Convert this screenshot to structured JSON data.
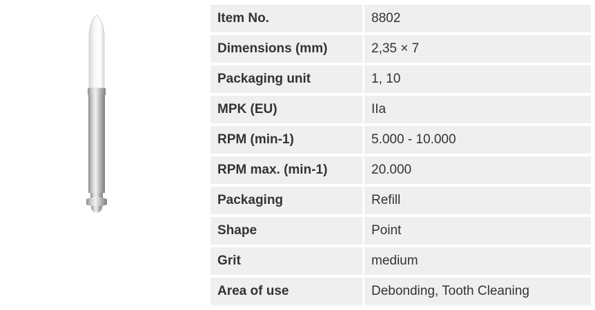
{
  "product": {
    "image_icon": "polishing-point-bur-icon"
  },
  "specs": [
    {
      "label": "Item No.",
      "value": "8802"
    },
    {
      "label": "Dimensions (mm)",
      "value": "2,35 × 7"
    },
    {
      "label": "Packaging unit",
      "value": "1, 10"
    },
    {
      "label": "MPK (EU)",
      "value": "IIa"
    },
    {
      "label": "RPM (min-1)",
      "value": "5.000 - 10.000"
    },
    {
      "label": "RPM max. (min-1)",
      "value": "20.000"
    },
    {
      "label": "Packaging",
      "value": "Refill"
    },
    {
      "label": "Shape",
      "value": "Point"
    },
    {
      "label": "Grit",
      "value": "medium"
    },
    {
      "label": "Area of use",
      "value": "Debonding, Tooth Cleaning"
    }
  ],
  "colors": {
    "row_background": "#efefef",
    "text": "#333333"
  }
}
